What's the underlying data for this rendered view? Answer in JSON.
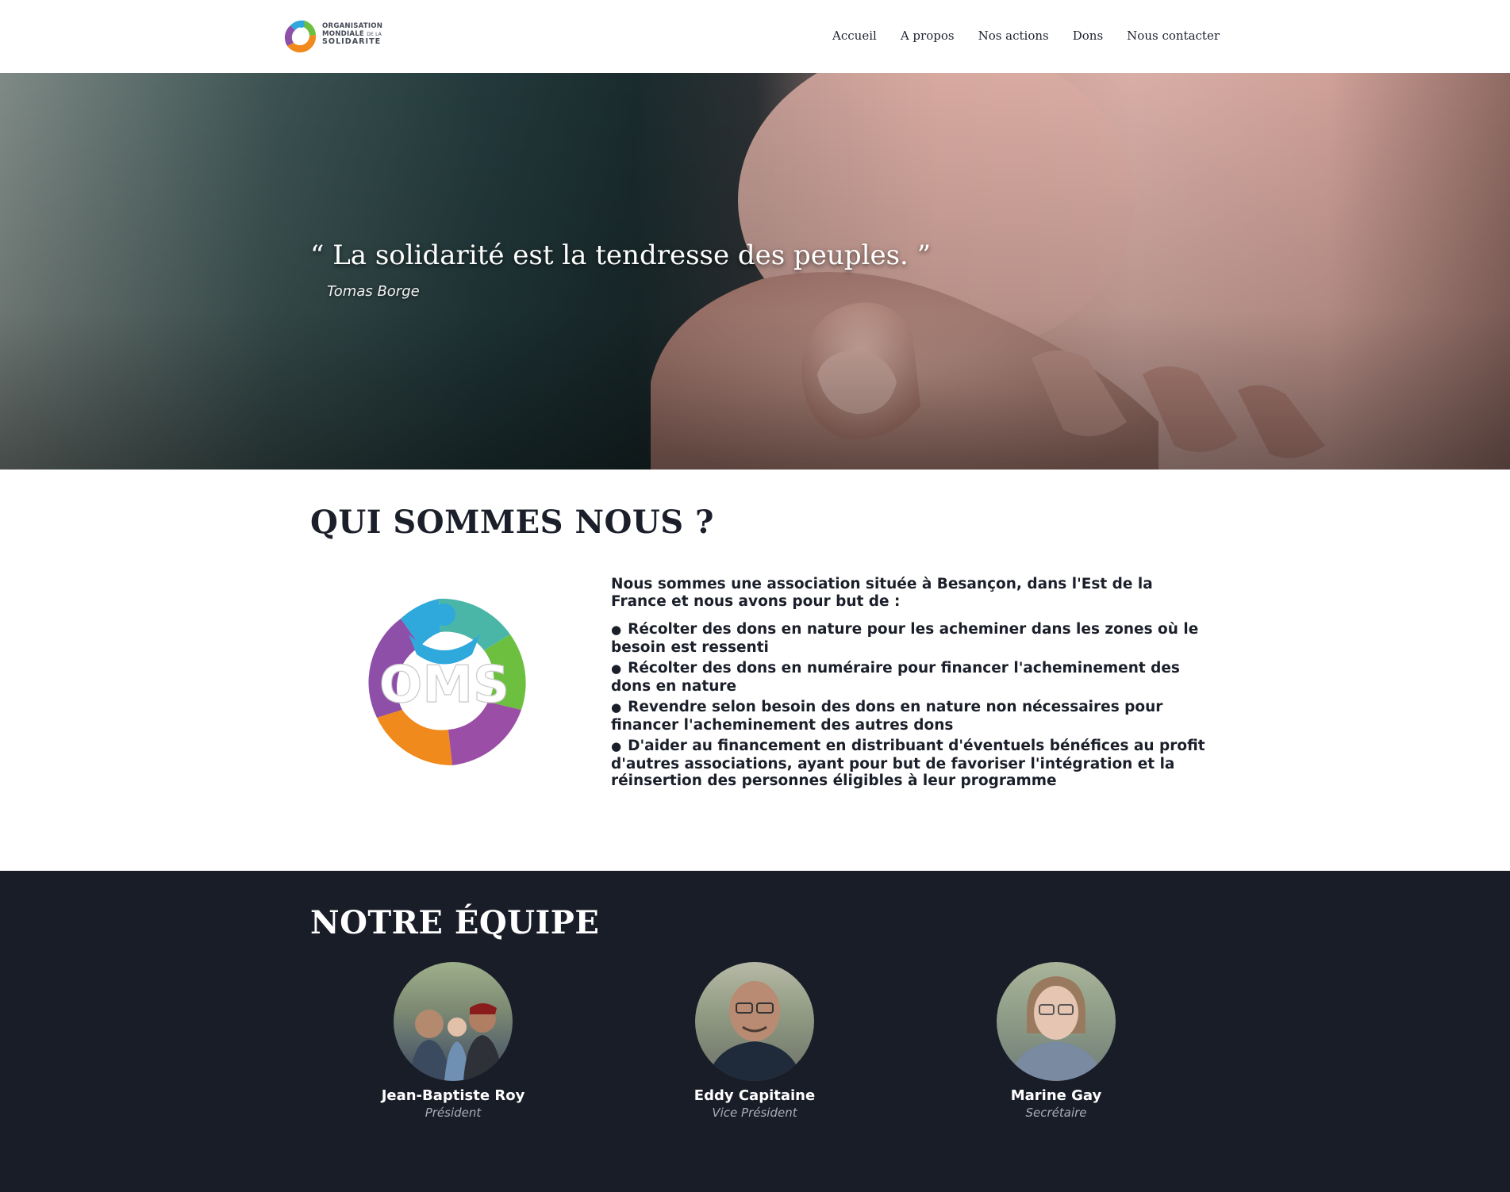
{
  "header": {
    "logo": {
      "line1": "ORGANISATION",
      "line2": "MONDIALE",
      "line2_suffix": "DE LA",
      "line3": "SOLIDARITE"
    },
    "nav": [
      "Accueil",
      "A propos",
      "Nos actions",
      "Dons",
      "Nous contacter"
    ]
  },
  "hero": {
    "quote": "“ La solidarité est la tendresse des peuples. ”",
    "author": "Tomas Borge"
  },
  "about": {
    "title": "QUI SOMMES NOUS ?",
    "logo_text": "OMS",
    "intro": "Nous sommes une association située à Besançon, dans l'Est de la France et nous avons pour but de :",
    "items": [
      "Récolter des dons en nature pour les acheminer dans les zones où le besoin est ressenti",
      "Récolter des dons en numéraire pour financer l'acheminement des dons en nature",
      "Revendre selon besoin des dons en nature non nécessaires pour financer l'acheminement des autres dons",
      "D'aider au financement en distribuant d'éventuels bénéfices au profit d'autres associations, ayant pour but de favoriser l'intégration et la réinsertion des personnes éligibles à leur programme"
    ]
  },
  "team": {
    "title": "NOTRE ÉQUIPE",
    "members": [
      {
        "name": "Jean-Baptiste Roy",
        "role": "Président"
      },
      {
        "name": "Eddy Capitaine",
        "role": "Vice Président"
      },
      {
        "name": "Marine Gay",
        "role": "Secrétaire"
      }
    ]
  },
  "colors": {
    "dark_bg": "#191d28",
    "text": "#1b1f2a",
    "logo_purple": "#8e4fa8",
    "logo_blue": "#2fa8dc",
    "logo_green": "#6cbf3f",
    "logo_orange": "#f08a1c"
  }
}
